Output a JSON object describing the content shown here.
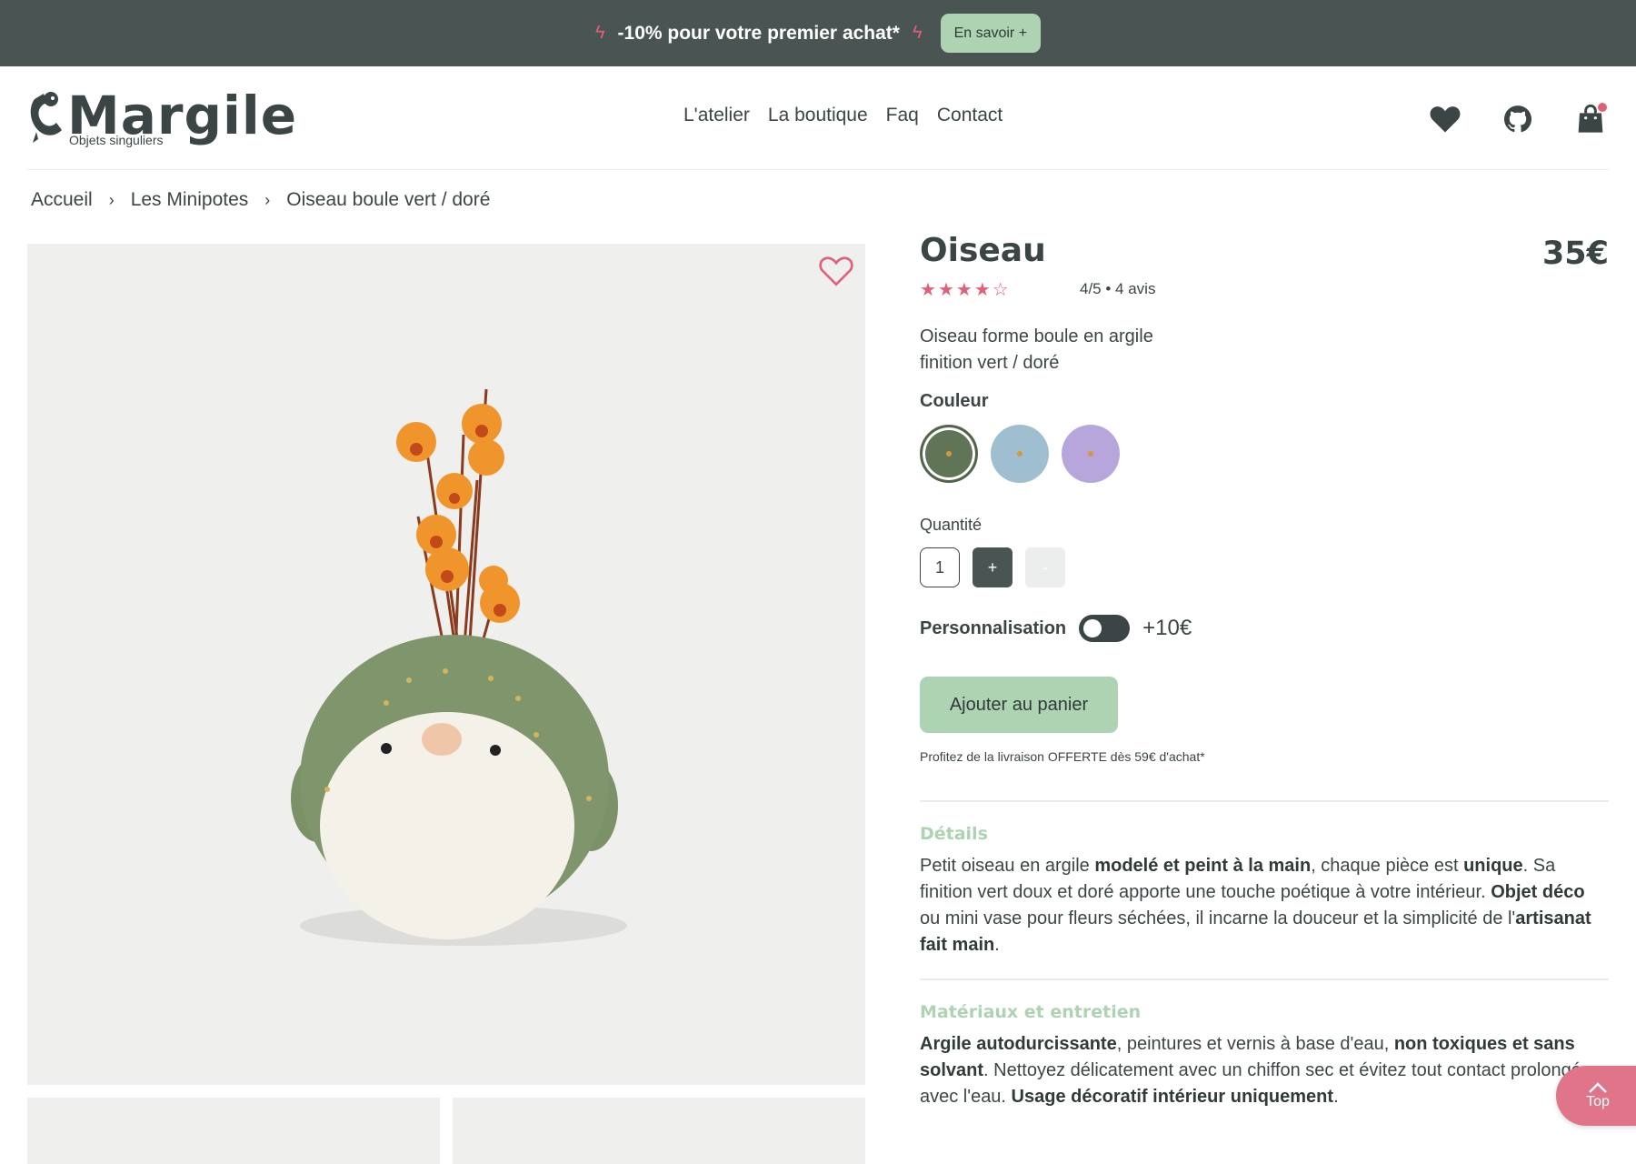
{
  "announcement": {
    "message": "-10% pour votre premier achat*",
    "cta": "En savoir +"
  },
  "brand": {
    "name": "Margile",
    "tagline": "Objets singuliers"
  },
  "nav": [
    "L'atelier",
    "La boutique",
    "Faq",
    "Contact"
  ],
  "header_icons": [
    "heart-icon",
    "github-icon",
    "shopping-bag-icon"
  ],
  "breadcrumb": [
    "Accueil",
    "Les Minipotes",
    "Oiseau boule vert / doré"
  ],
  "product": {
    "title": "Oiseau",
    "price": "35€",
    "rating": 4,
    "rating_max": 5,
    "rating_text": "4/5 • 4 avis",
    "description_line1": "Oiseau forme boule en argile",
    "description_line2": "finition vert / doré",
    "color_label": "Couleur",
    "colors": [
      "#5f7556",
      "#9fbfd0",
      "#b7a6dc"
    ],
    "quantity_label": "Quantité",
    "quantity": "1",
    "plus": "+",
    "minus": "-",
    "personalisation_label": "Personnalisation",
    "personalisation_price": "+10€",
    "add_to_cart": "Ajouter au panier",
    "shipping_note": "Profitez de la livraison OFFERTE dès 59€ d'achat*"
  },
  "details": {
    "title": "Détails",
    "p1": "Petit oiseau en argile ",
    "b1": "modelé et peint à la main",
    "p2": ", chaque pièce est ",
    "b2": "unique",
    "p3": ". Sa finition vert doux et doré apporte une touche poétique à votre intérieur. ",
    "b3": "Objet déco",
    "p4": " ou mini vase pour fleurs séchées, il incarne la douceur et la simplicité de l'",
    "b4": "artisanat fait main",
    "p5": "."
  },
  "materials": {
    "title": "Matériaux et entretien",
    "b1": "Argile autodurcissante",
    "p1": ", peintures et vernis à base d'eau, ",
    "b2": "non toxiques et sans solvant",
    "p2": ". Nettoyez délicatement avec un chiffon sec et évitez tout contact prolongé avec l'eau. ",
    "b3": "Usage décoratif intérieur uniquement",
    "p3": "."
  },
  "top_button": "Top",
  "colors": {
    "accent_green": "#aed3b2",
    "dark": "#4a5453",
    "pink": "#e0607a"
  }
}
